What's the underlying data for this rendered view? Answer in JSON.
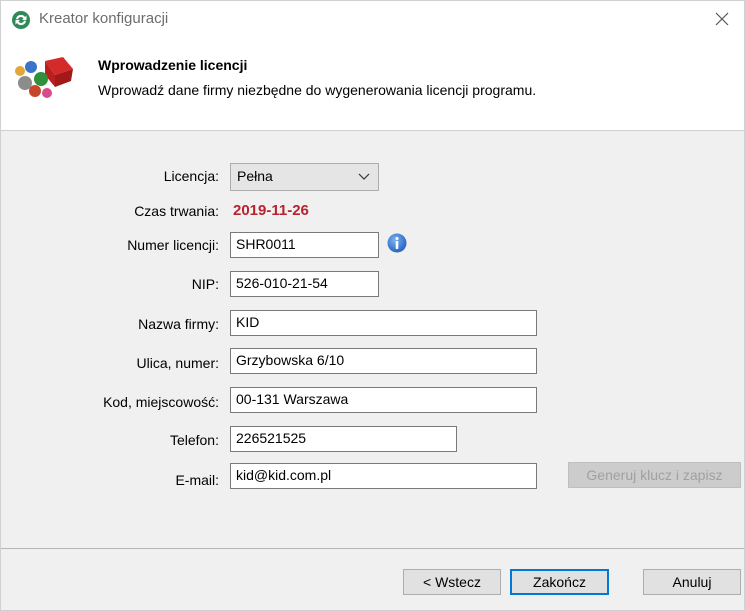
{
  "window": {
    "title": "Kreator konfiguracji",
    "close_icon": "close-icon"
  },
  "header": {
    "title": "Wprowadzenie licencji",
    "subtitle": "Wprowadź dane firmy niezbędne do wygenerowania licencji programu."
  },
  "form": {
    "license_label": "Licencja:",
    "license_value": "Pełna",
    "duration_label": "Czas trwania:",
    "duration_value": "2019-11-26",
    "duration_color": "#b8222f",
    "license_number_label": "Numer licencji:",
    "license_number_value": "SHR0011",
    "nip_label": "NIP:",
    "nip_value": "526-010-21-54",
    "company_label": "Nazwa firmy:",
    "company_value": "KID",
    "street_label": "Ulica, numer:",
    "street_value": "Grzybowska 6/10",
    "city_label": "Kod, miejscowość:",
    "city_value": "00-131 Warszawa",
    "phone_label": "Telefon:",
    "phone_value": "226521525",
    "email_label": "E-mail:",
    "email_value": "kid@kid.com.pl",
    "generate_button": "Generuj klucz i zapisz"
  },
  "footer": {
    "back_button": "< Wstecz",
    "finish_button": "Zakończ",
    "cancel_button": "Anuluj"
  },
  "colors": {
    "accent": "#0078d7",
    "panel": "#f0f0f0"
  }
}
